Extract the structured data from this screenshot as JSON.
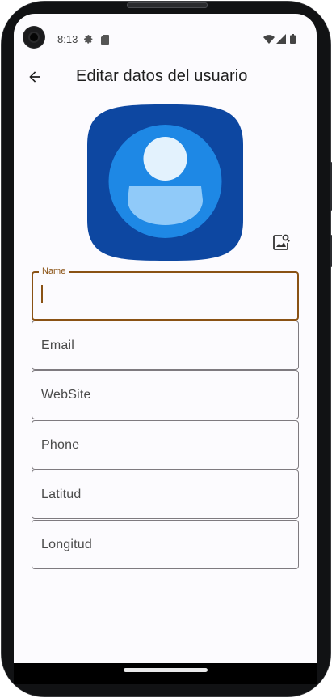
{
  "status_bar": {
    "time": "8:13"
  },
  "app_bar": {
    "title": "Editar datos del usuario"
  },
  "form": {
    "fields": [
      {
        "label": "Name",
        "value": ""
      },
      {
        "label": "Email"
      },
      {
        "label": "WebSite"
      },
      {
        "label": "Phone"
      },
      {
        "label": "Latitud"
      },
      {
        "label": "Longitud"
      }
    ]
  },
  "colors": {
    "accent": "#8a5214",
    "avatar_bg": "#0d47a1",
    "avatar_circle": "#1e88e5",
    "avatar_figure_light": "#e3f2fd",
    "avatar_figure_body": "#90caf9"
  },
  "icons": [
    "back-arrow-icon",
    "pick-image-icon",
    "settings-icon",
    "sim-card-icon",
    "wifi-icon",
    "signal-icon",
    "battery-icon"
  ]
}
